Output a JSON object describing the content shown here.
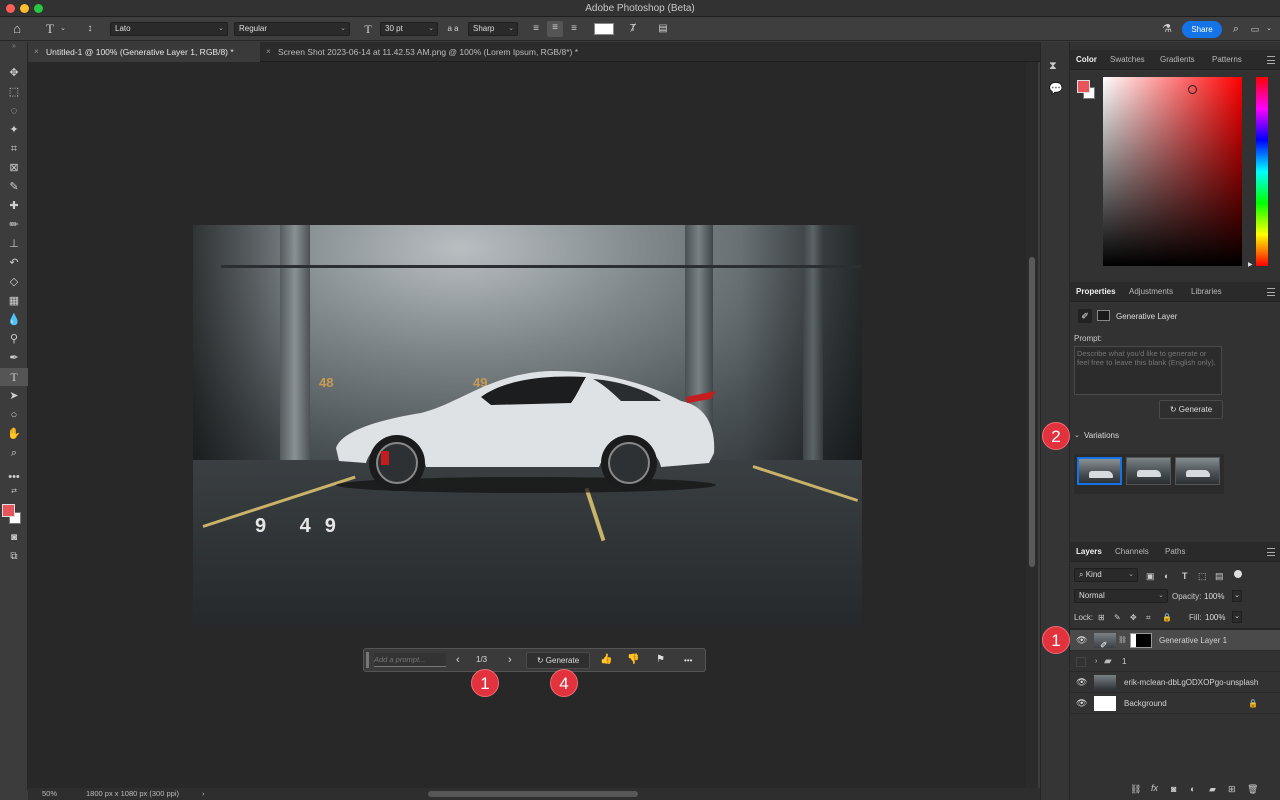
{
  "app": {
    "title": "Adobe Photoshop (Beta)"
  },
  "options_bar": {
    "tool_symbol": "T",
    "font_family": "Lato",
    "font_style": "Regular",
    "font_size": "30 pt",
    "aa_symbol": "a a",
    "antialias": "Sharp",
    "share_label": "Share"
  },
  "tabs": [
    {
      "label": "Untitled-1 @ 100% (Generative Layer 1, RGB/8) *",
      "active": true
    },
    {
      "label": "Screen Shot 2023-06-14 at 11.42.53 AM.png @ 100% (Lorem Ipsum, RGB/8*) *",
      "active": false
    }
  ],
  "status": {
    "zoom": "50%",
    "doc_info": "1800 px x 1080 px (300 ppi)",
    "arrow": "›"
  },
  "image_text": {
    "num1": "48",
    "num2": "49",
    "num3": "9 49"
  },
  "contextual_taskbar": {
    "prompt_placeholder": "Add a prompt...",
    "counter": "1/3",
    "generate_label": "Generate",
    "more": "•••"
  },
  "callouts": {
    "taskbar_counter": "1",
    "taskbar_generate": "4",
    "variations": "2",
    "layer": "1"
  },
  "color_panel": {
    "tabs": [
      "Color",
      "Swatches",
      "Gradients",
      "Patterns"
    ],
    "foreground": "#e8555a",
    "background": "#ffffff"
  },
  "properties_panel": {
    "tabs": [
      "Properties",
      "Adjustments",
      "Libraries"
    ],
    "layer_type": "Generative Layer",
    "prompt_label": "Prompt:",
    "prompt_placeholder": "Describe what you'd like to generate or feel free to leave this blank (English only).",
    "generate_label": "Generate",
    "variations_label": "Variations"
  },
  "layers_panel": {
    "tabs": [
      "Layers",
      "Channels",
      "Paths"
    ],
    "filter_kind": "Kind",
    "blend_mode": "Normal",
    "opacity_label": "Opacity:",
    "opacity_value": "100%",
    "lock_label": "Lock:",
    "fill_label": "Fill:",
    "fill_value": "100%",
    "layers": [
      {
        "name": "Generative Layer 1",
        "visible": true,
        "selected": true
      },
      {
        "name": "1",
        "visible": false,
        "selected": false
      },
      {
        "name": "erik-mclean-dbLgODXOPgo-unsplash",
        "visible": true,
        "selected": false
      },
      {
        "name": "Background",
        "visible": true,
        "selected": false
      }
    ],
    "fx_label": "fx"
  },
  "colors": {
    "accent": "#1473e6",
    "callout": "#e1323e"
  }
}
